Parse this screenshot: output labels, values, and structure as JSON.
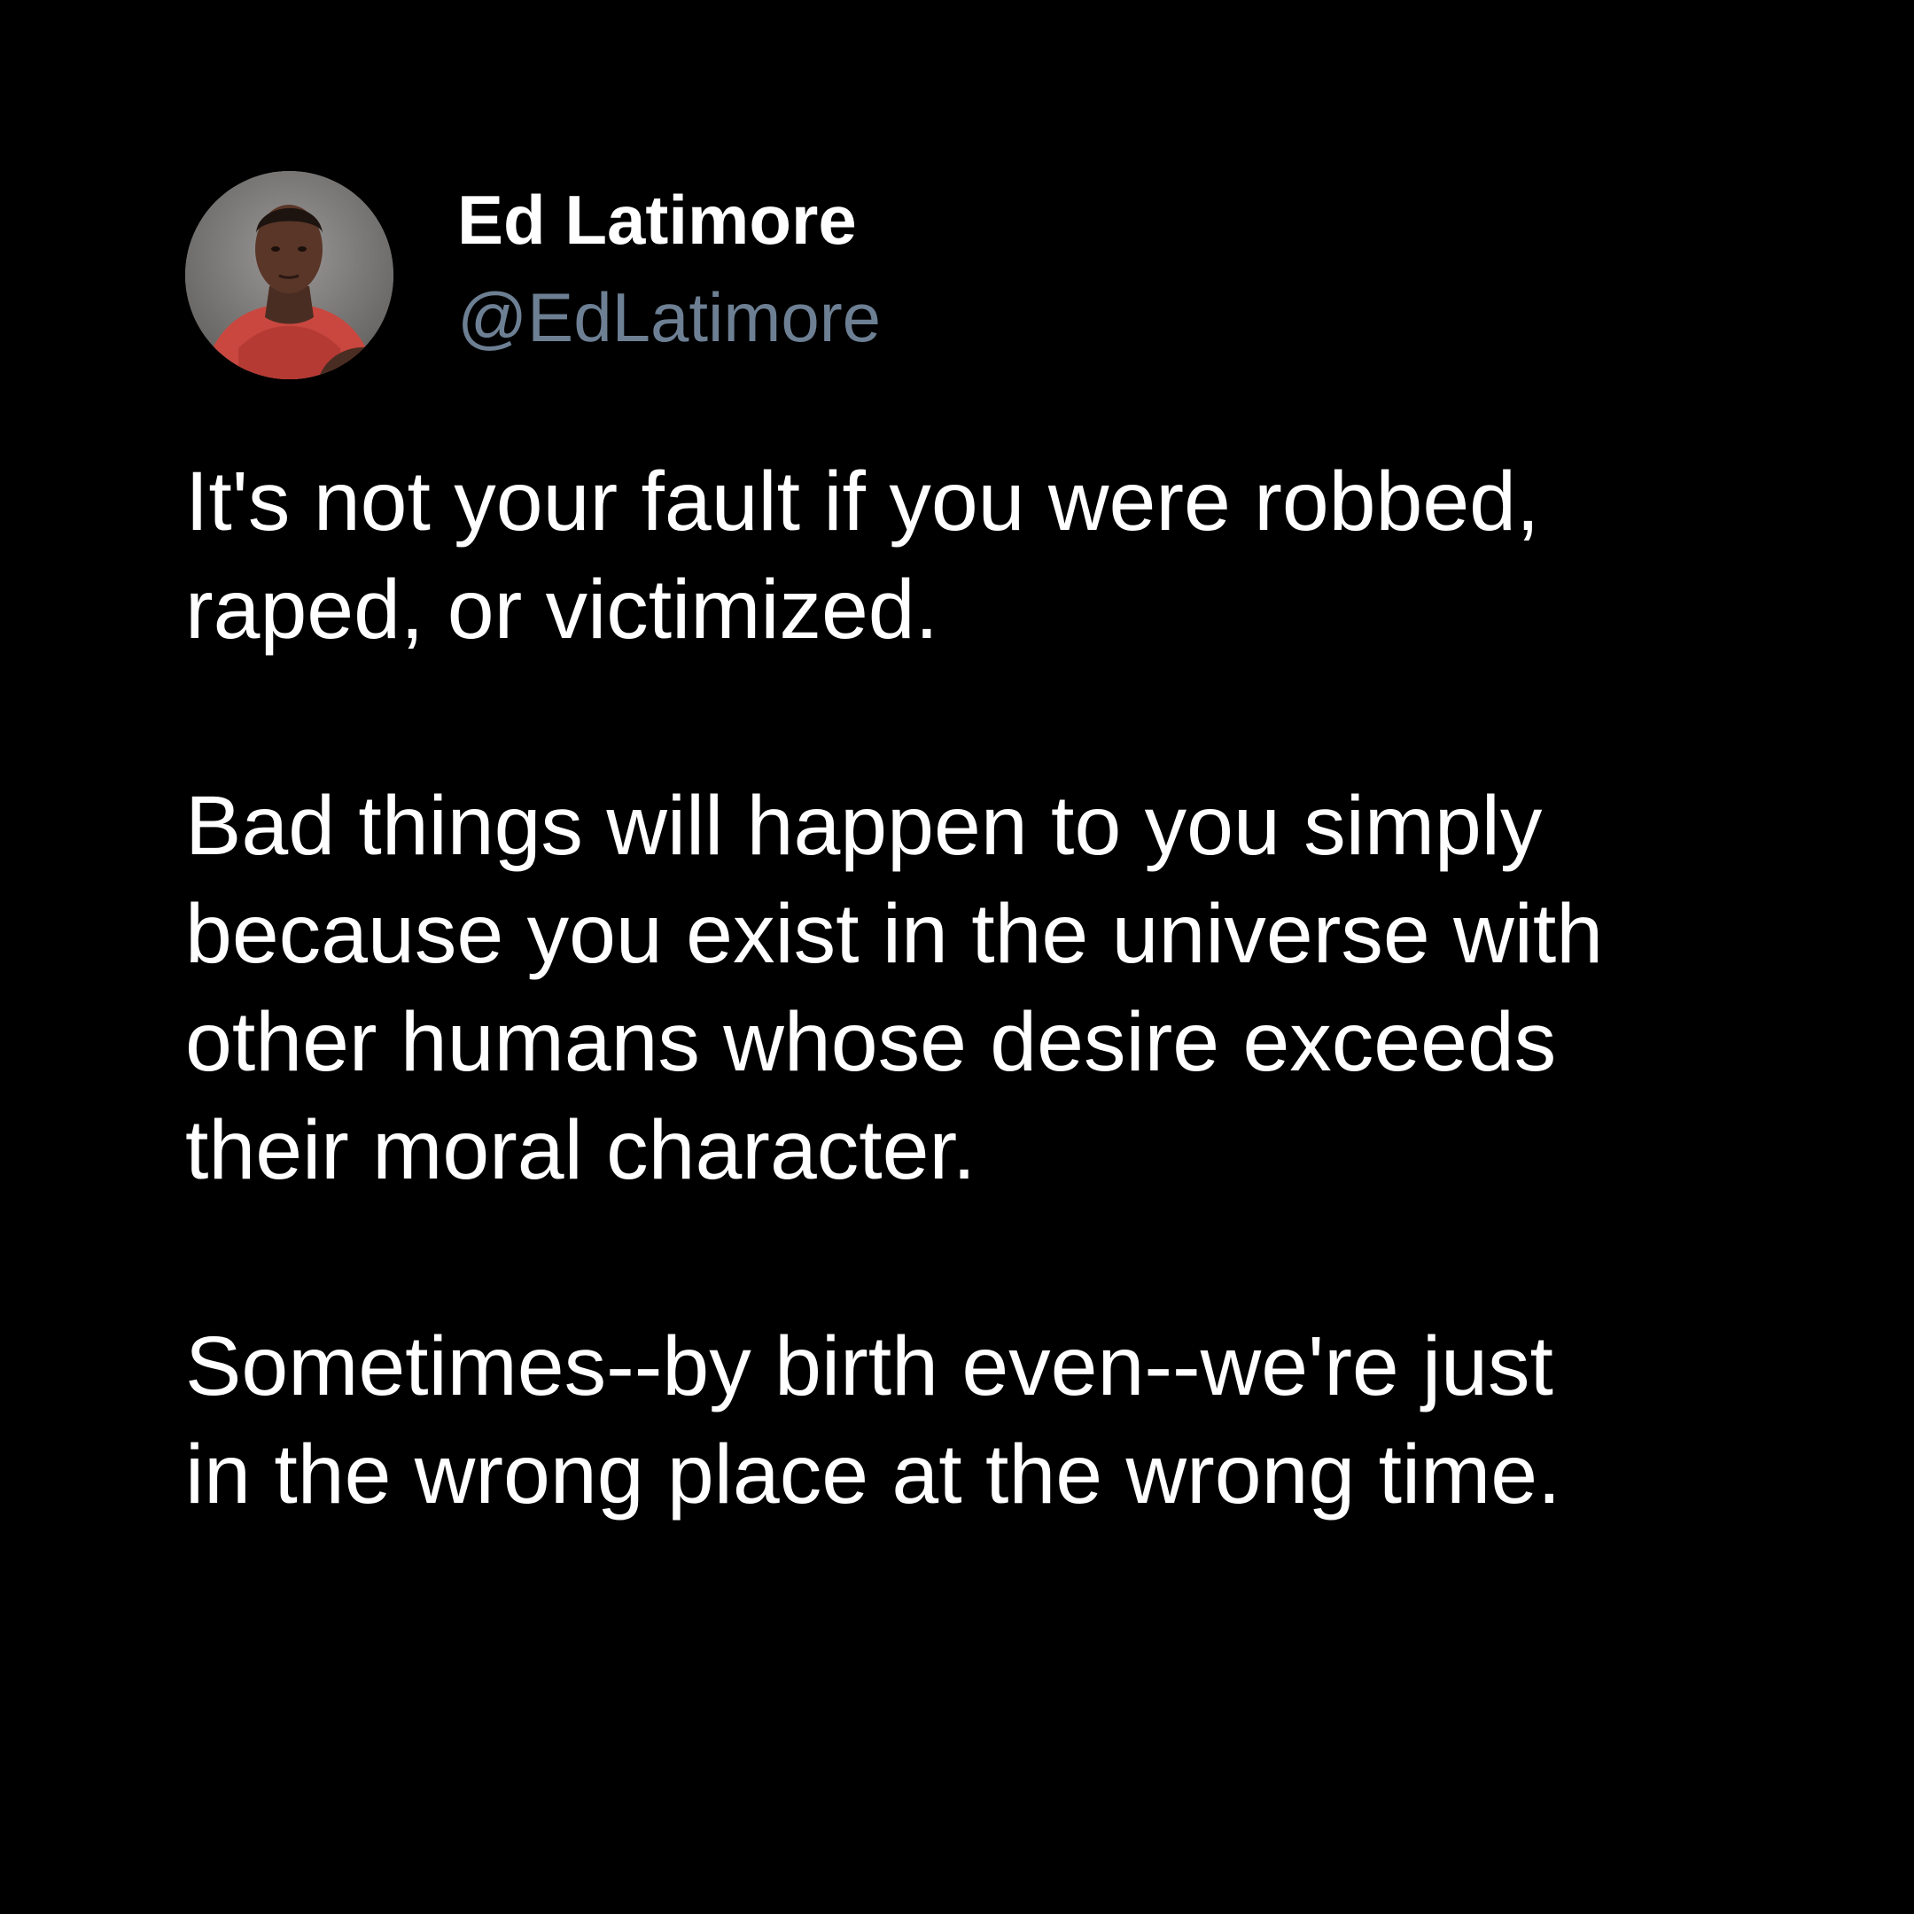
{
  "background_color": "#000000",
  "text_color": "#ffffff",
  "handle_color": "#6d7f93",
  "author": {
    "display_name": "Ed Latimore",
    "handle": "@EdLatimore",
    "avatar_icon": "profile-photo"
  },
  "tweet": {
    "paragraphs": [
      {
        "lines": [
          "It's not your fault if you were robbed,",
          "raped, or victimized."
        ]
      },
      {
        "lines": [
          "Bad things will happen to you simply",
          "because you exist in the universe with",
          "other humans whose desire exceeds",
          "their moral character."
        ]
      },
      {
        "lines": [
          "Sometimes--by birth even--we're just",
          "in the wrong place at the wrong time."
        ]
      }
    ]
  }
}
